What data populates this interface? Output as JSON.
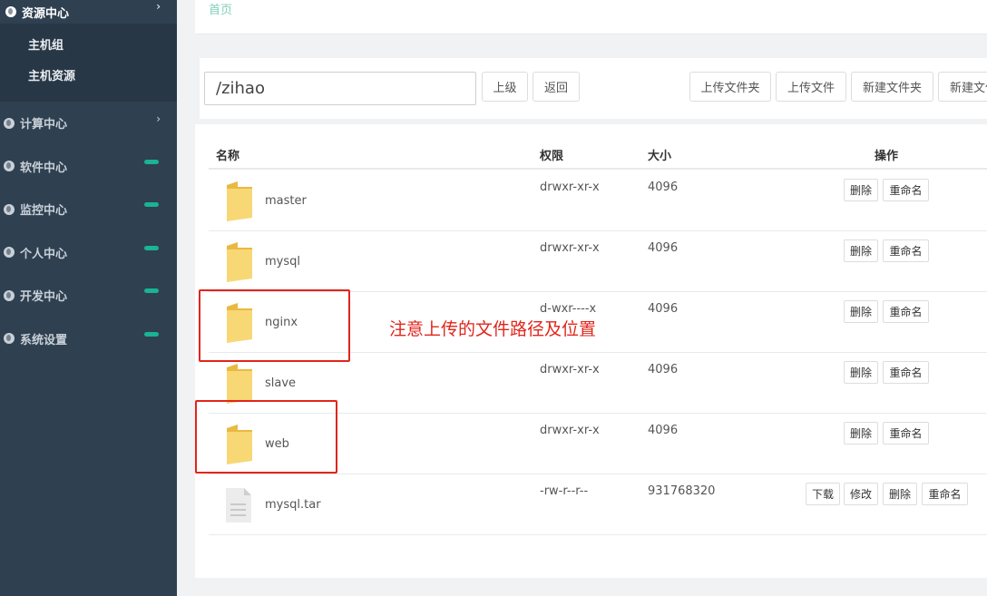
{
  "sidebar": {
    "active": "资源中心",
    "sub_items": [
      "主机组",
      "主机资源"
    ],
    "items": [
      {
        "label": "计算中心",
        "indicator": "chevron"
      },
      {
        "label": "软件中心",
        "indicator": "pill"
      },
      {
        "label": "监控中心",
        "indicator": "pill"
      },
      {
        "label": "个人中心",
        "indicator": "pill"
      },
      {
        "label": "开发中心",
        "indicator": "pill"
      },
      {
        "label": "系统设置",
        "indicator": "pill"
      }
    ],
    "pill_color": "#1ab394"
  },
  "breadcrumb": {
    "home": "首页"
  },
  "toolbar": {
    "path_value": "/zihao",
    "up": "上级",
    "back": "返回",
    "upload_folder": "上传文件夹",
    "upload_file": "上传文件",
    "new_folder": "新建文件夹",
    "new_file": "新建文件"
  },
  "table": {
    "headers": {
      "name": "名称",
      "perm": "权限",
      "size": "大小",
      "ops": "操作"
    },
    "rows": [
      {
        "name": "master",
        "perm": "drwxr-xr-x",
        "size": "4096",
        "type": "folder"
      },
      {
        "name": "mysql",
        "perm": "drwxr-xr-x",
        "size": "4096",
        "type": "folder"
      },
      {
        "name": "nginx",
        "perm": "d-wxr----x",
        "size": "4096",
        "type": "folder"
      },
      {
        "name": "slave",
        "perm": "drwxr-xr-x",
        "size": "4096",
        "type": "folder"
      },
      {
        "name": "web",
        "perm": "drwxr-xr-x",
        "size": "4096",
        "type": "folder"
      },
      {
        "name": "mysql.tar",
        "perm": "-rw-r--r--",
        "size": "931768320",
        "type": "file"
      }
    ],
    "actions": {
      "download": "下载",
      "edit": "修改",
      "delete": "删除",
      "rename": "重命名"
    }
  },
  "annotation": {
    "note": "注意上传的文件路径及位置",
    "color": "#e1251b"
  },
  "icons": {
    "folder": "folder-icon",
    "file": "file-icon",
    "nav": "globe-icon",
    "chevron": "chevron-right-icon"
  }
}
